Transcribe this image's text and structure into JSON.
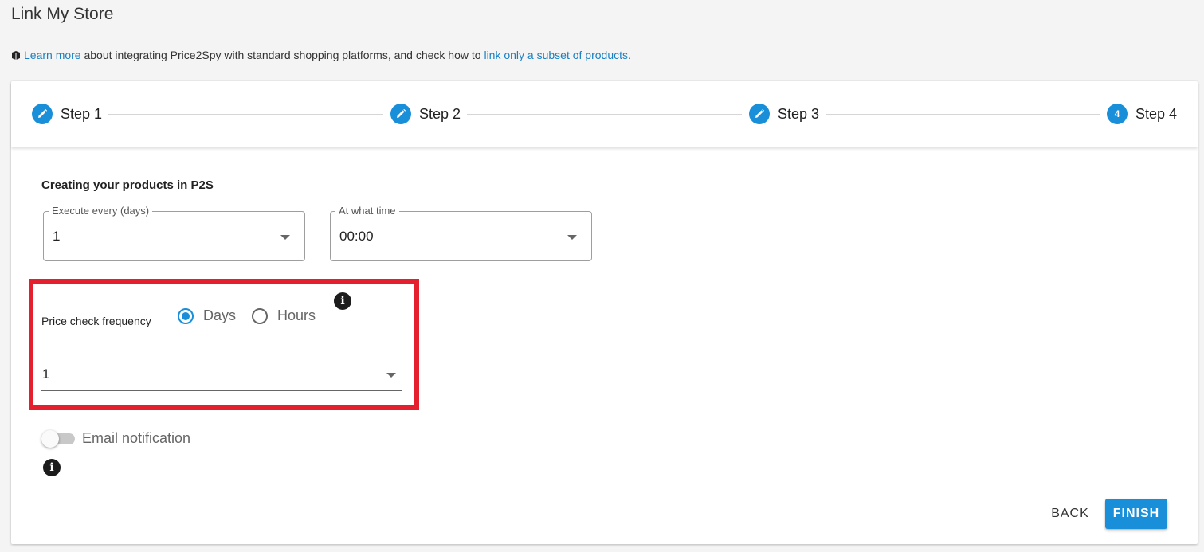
{
  "page": {
    "title": "Link My Store"
  },
  "info": {
    "learn_more_link": "Learn more",
    "text_middle": " about integrating Price2Spy with standard shopping platforms, and check how to ",
    "subset_link": "link only a subset of products",
    "text_end": "."
  },
  "stepper": {
    "steps": [
      {
        "label": "Step 1",
        "state": "edit",
        "icon": "pencil-icon"
      },
      {
        "label": "Step 2",
        "state": "edit",
        "icon": "pencil-icon"
      },
      {
        "label": "Step 3",
        "state": "edit",
        "icon": "pencil-icon"
      },
      {
        "label": "Step 4",
        "state": "active",
        "number": "4"
      }
    ]
  },
  "form": {
    "section_heading": "Creating your products in P2S",
    "execute_every": {
      "label": "Execute every (days)",
      "value": "1"
    },
    "at_what_time": {
      "label": "At what time",
      "value": "00:00"
    },
    "price_check": {
      "label": "Price check frequency",
      "options": [
        {
          "label": "Days",
          "checked": true
        },
        {
          "label": "Hours",
          "checked": false
        }
      ],
      "value": "1"
    },
    "email_notification": {
      "label": "Email notification",
      "enabled": false
    }
  },
  "actions": {
    "back_label": "BACK",
    "finish_label": "FINISH"
  },
  "colors": {
    "accent": "#1a8fd9",
    "highlight": "#e4202e",
    "link": "#1a7fc2"
  }
}
